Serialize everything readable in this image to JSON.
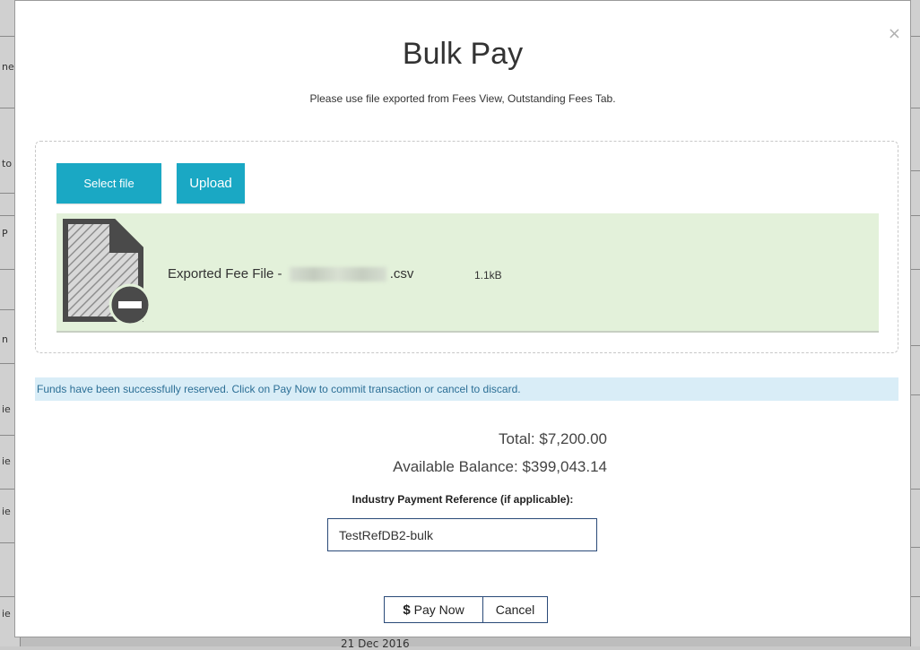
{
  "modal": {
    "title": "Bulk Pay",
    "subtitle": "Please use file exported from Fees View, Outstanding Fees Tab.",
    "close_icon": "×"
  },
  "upload": {
    "select_label": "Select file",
    "upload_label": "Upload",
    "file": {
      "name_prefix": "Exported Fee File - ",
      "name_suffix": ".csv",
      "size": "1.1kB",
      "icon": "file-remove-icon"
    }
  },
  "alert": {
    "message": "Funds have been successfully reserved. Click on Pay Now to commit transaction or cancel to discard."
  },
  "summary": {
    "total": "Total: $7,200.00",
    "balance": "Available Balance: $399,043.14"
  },
  "reference": {
    "label": "Industry Payment Reference (if applicable):",
    "value": "TestRefDB2-bulk"
  },
  "actions": {
    "pay_icon": "$",
    "pay_label": "Pay Now",
    "cancel_label": "Cancel"
  },
  "background": {
    "bottom_text": "21 Dec 2016",
    "left_fragments": [
      "ne",
      "to",
      "P",
      "n",
      "ie",
      "ie",
      "ie",
      "ie"
    ]
  },
  "colors": {
    "accent": "#1aa8c4",
    "file_row_bg": "#e3f1da",
    "alert_bg": "#d9edf7",
    "alert_text": "#2c6f96",
    "button_border": "#2a4a78"
  }
}
